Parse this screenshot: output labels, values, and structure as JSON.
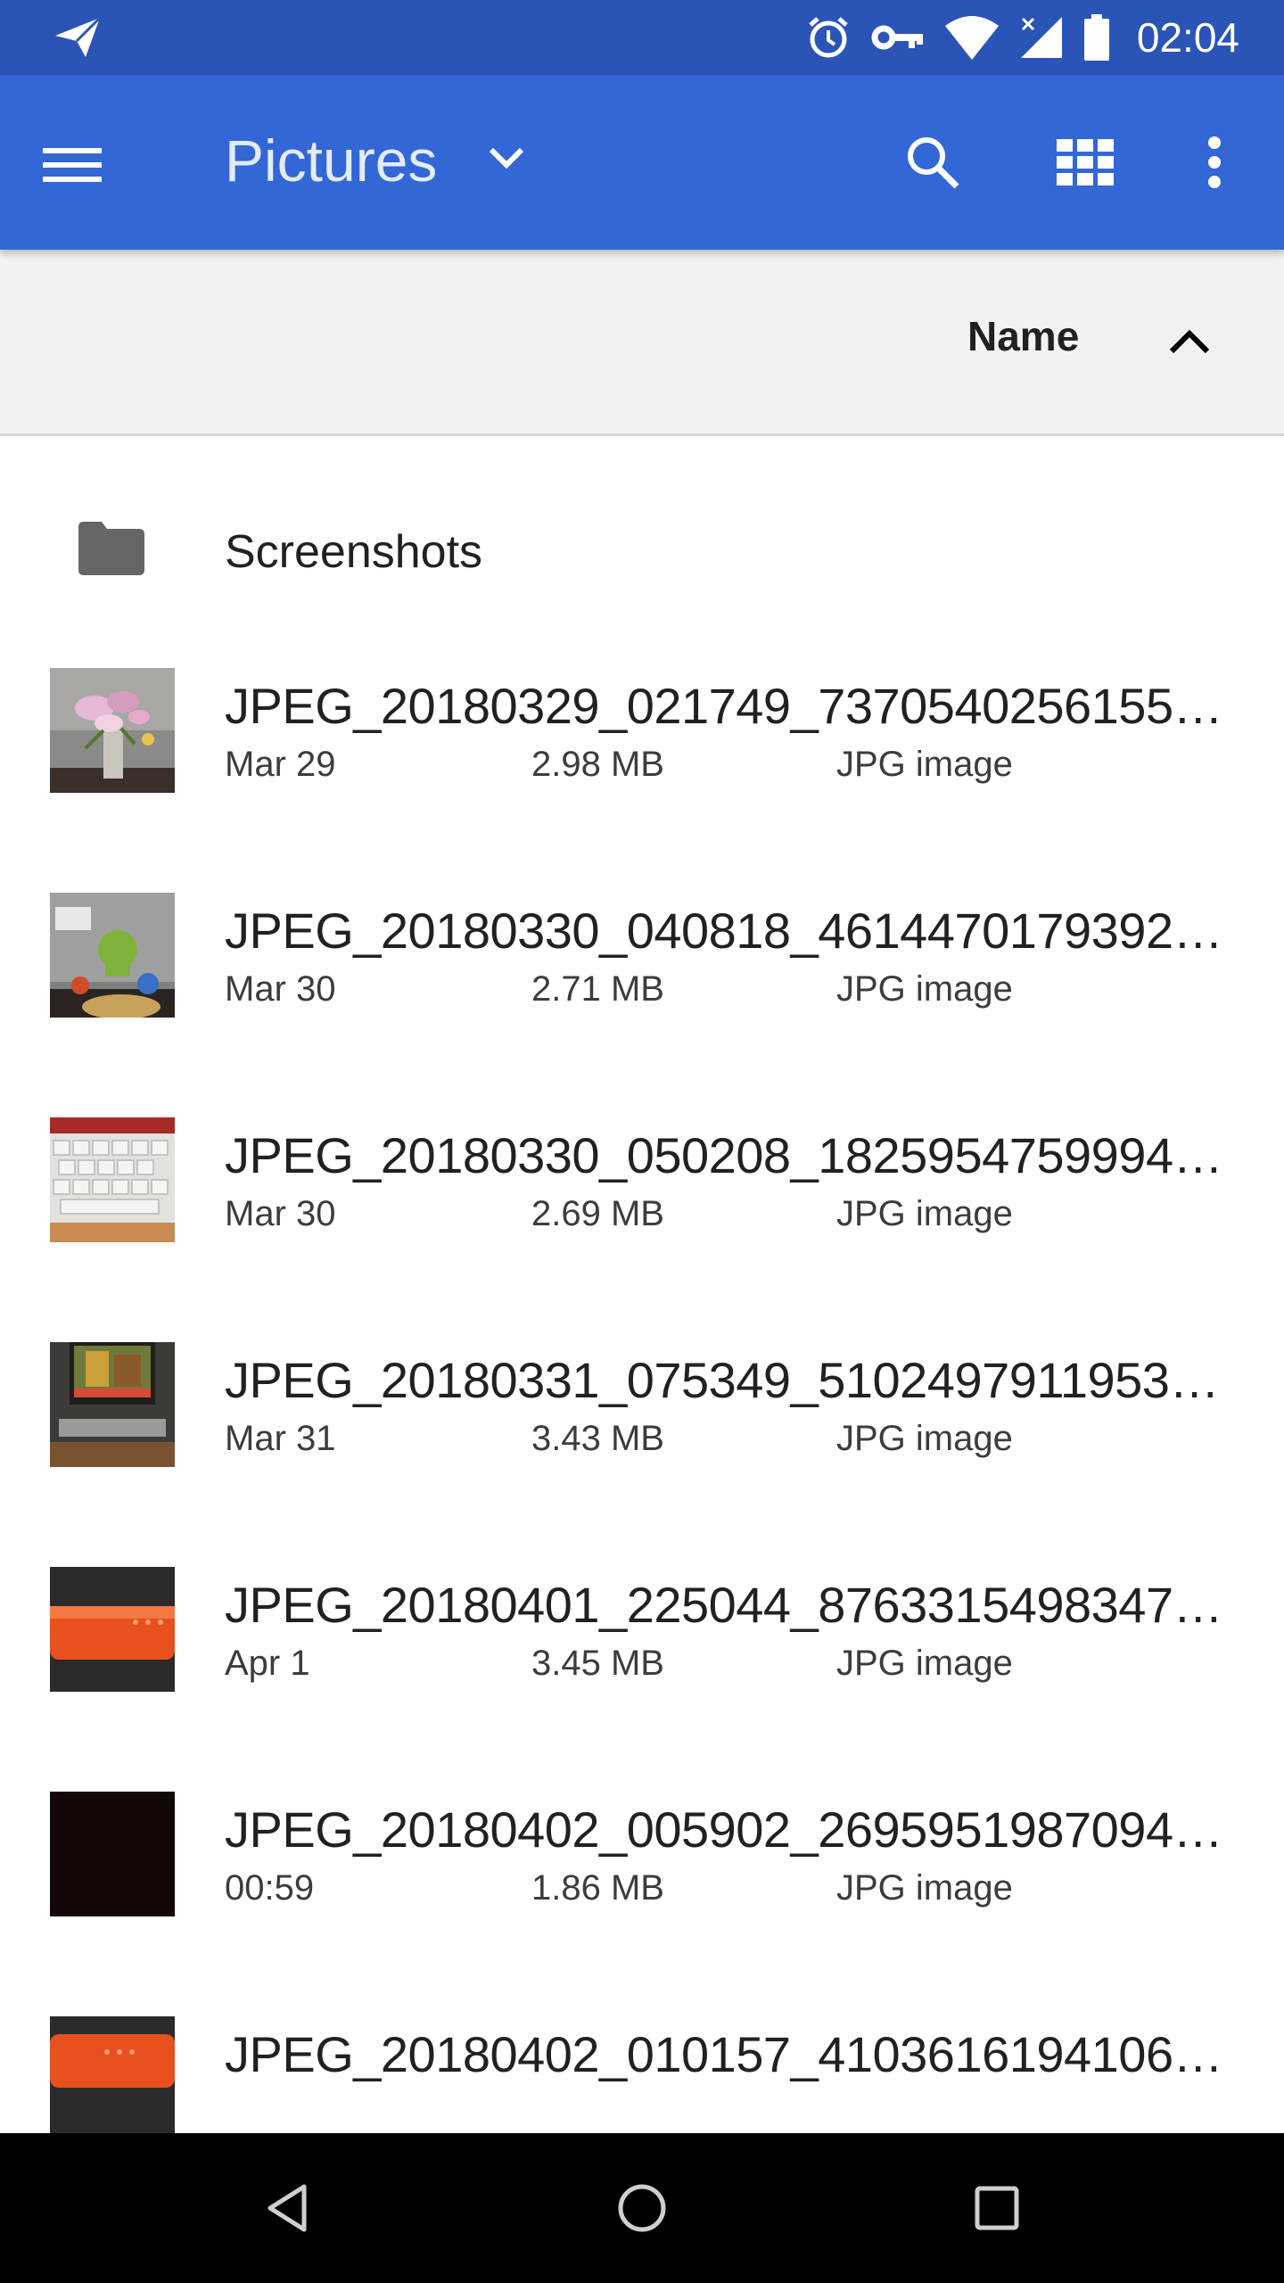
{
  "status_bar": {
    "time": "02:04",
    "icons": [
      "send-icon",
      "alarm-icon",
      "vpn-key-icon",
      "wifi-icon",
      "signal-icon",
      "battery-icon"
    ]
  },
  "app_bar": {
    "title": "Pictures",
    "icons": [
      "menu-icon",
      "chevron-down-icon",
      "search-icon",
      "grid-view-icon",
      "more-vert-icon"
    ]
  },
  "sort_bar": {
    "label": "Name",
    "direction_icon": "chevron-up-icon"
  },
  "folder": {
    "label": "Screenshots",
    "icon": "folder-icon"
  },
  "files": [
    {
      "name": "JPEG_20180329_021749_73705402561553...",
      "date": "Mar 29",
      "size": "2.98 MB",
      "type": "JPG image",
      "thumb": "flowers"
    },
    {
      "name": "JPEG_20180330_040818_46144701793925...",
      "date": "Mar 30",
      "size": "2.71 MB",
      "type": "JPG image",
      "thumb": "laptop-stickers"
    },
    {
      "name": "JPEG_20180330_050208_18259547599940...",
      "date": "Mar 30",
      "size": "2.69 MB",
      "type": "JPG image",
      "thumb": "keyboard"
    },
    {
      "name": "JPEG_20180331_075349_51024979119532...",
      "date": "Mar 31",
      "size": "3.43 MB",
      "type": "JPG image",
      "thumb": "monitor-desk"
    },
    {
      "name": "JPEG_20180401_225044_87633154983475...",
      "date": "Apr 1",
      "size": "3.45 MB",
      "type": "JPG image",
      "thumb": "orange-device"
    },
    {
      "name": "JPEG_20180402_005902_26959519870941...",
      "date": "00:59",
      "size": "1.86 MB",
      "type": "JPG image",
      "thumb": "dark"
    },
    {
      "name": "JPEG_20180402_010157_41036161941063...",
      "date": "",
      "size": "",
      "type": "",
      "thumb": "orange-device"
    }
  ],
  "nav_bar": {
    "icons": [
      "back-icon",
      "home-icon",
      "recents-icon"
    ]
  },
  "colors": {
    "status_bar": "#2b54b7",
    "app_bar": "#3367d6",
    "sort_bar": "#f2f2f2",
    "nav_bar": "#000000"
  }
}
